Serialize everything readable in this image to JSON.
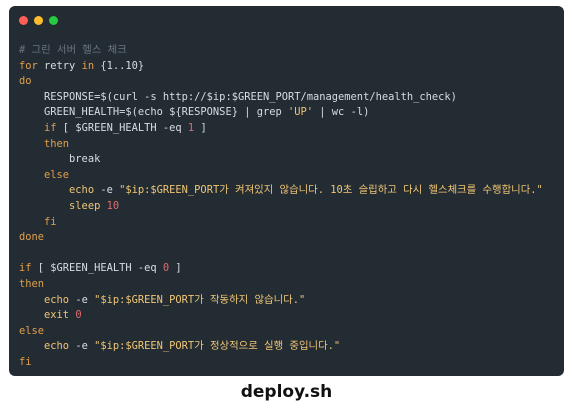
{
  "window": {
    "dots": [
      {
        "name": "close-dot",
        "color": "#ff5f57"
      },
      {
        "name": "minimize-dot",
        "color": "#febc2e"
      },
      {
        "name": "maximize-dot",
        "color": "#28c840"
      }
    ]
  },
  "code": {
    "lines": [
      [
        {
          "t": "# 그린 서버 헬스 체크",
          "c": "cmt"
        }
      ],
      [
        {
          "t": "for",
          "c": "kw"
        },
        {
          "t": " retry ",
          "c": "var"
        },
        {
          "t": "in",
          "c": "kw"
        },
        {
          "t": " {1..10}",
          "c": "var"
        }
      ],
      [
        {
          "t": "do",
          "c": "kw"
        }
      ],
      [
        {
          "t": "    RESPONSE=$(curl -s http://$ip:$GREEN_PORT/management/health_check)",
          "c": "var"
        }
      ],
      [
        {
          "t": "    GREEN_HEALTH=$(echo ${RESPONSE} | grep ",
          "c": "var"
        },
        {
          "t": "'UP'",
          "c": "str"
        },
        {
          "t": " | wc -l)",
          "c": "var"
        }
      ],
      [
        {
          "t": "    ",
          "c": "var"
        },
        {
          "t": "if",
          "c": "kw"
        },
        {
          "t": " [ $GREEN_HEALTH -eq ",
          "c": "var"
        },
        {
          "t": "1",
          "c": "num"
        },
        {
          "t": " ]",
          "c": "var"
        }
      ],
      [
        {
          "t": "    ",
          "c": "var"
        },
        {
          "t": "then",
          "c": "kw"
        }
      ],
      [
        {
          "t": "        break",
          "c": "var"
        }
      ],
      [
        {
          "t": "    ",
          "c": "var"
        },
        {
          "t": "else",
          "c": "kw"
        }
      ],
      [
        {
          "t": "        ",
          "c": "var"
        },
        {
          "t": "echo",
          "c": "cmd"
        },
        {
          "t": " -e ",
          "c": "var"
        },
        {
          "t": "\"$ip:$GREEN_PORT가 켜져있지 않습니다. 10초 슬립하고 다시 헬스체크를 수행합니다.\"",
          "c": "str"
        }
      ],
      [
        {
          "t": "        ",
          "c": "var"
        },
        {
          "t": "sleep",
          "c": "cmd"
        },
        {
          "t": " 10",
          "c": "num"
        }
      ],
      [
        {
          "t": "    ",
          "c": "var"
        },
        {
          "t": "fi",
          "c": "kw"
        }
      ],
      [
        {
          "t": "done",
          "c": "kw"
        }
      ],
      [
        {
          "t": "",
          "c": "var"
        }
      ],
      [
        {
          "t": "if",
          "c": "kw"
        },
        {
          "t": " [ $GREEN_HEALTH -eq ",
          "c": "var"
        },
        {
          "t": "0",
          "c": "num"
        },
        {
          "t": " ]",
          "c": "var"
        }
      ],
      [
        {
          "t": "then",
          "c": "kw"
        }
      ],
      [
        {
          "t": "    ",
          "c": "var"
        },
        {
          "t": "echo",
          "c": "cmd"
        },
        {
          "t": " -e ",
          "c": "var"
        },
        {
          "t": "\"$ip:$GREEN_PORT가 작동하지 않습니다.\"",
          "c": "str"
        }
      ],
      [
        {
          "t": "    ",
          "c": "var"
        },
        {
          "t": "exit",
          "c": "cmd"
        },
        {
          "t": " 0",
          "c": "num"
        }
      ],
      [
        {
          "t": "else",
          "c": "kw"
        }
      ],
      [
        {
          "t": "    ",
          "c": "var"
        },
        {
          "t": "echo",
          "c": "cmd"
        },
        {
          "t": " -e ",
          "c": "var"
        },
        {
          "t": "\"$ip:$GREEN_PORT가 정상적으로 실행 중입니다.\"",
          "c": "str"
        }
      ],
      [
        {
          "t": "fi",
          "c": "kw"
        }
      ]
    ]
  },
  "caption": "deploy.sh"
}
